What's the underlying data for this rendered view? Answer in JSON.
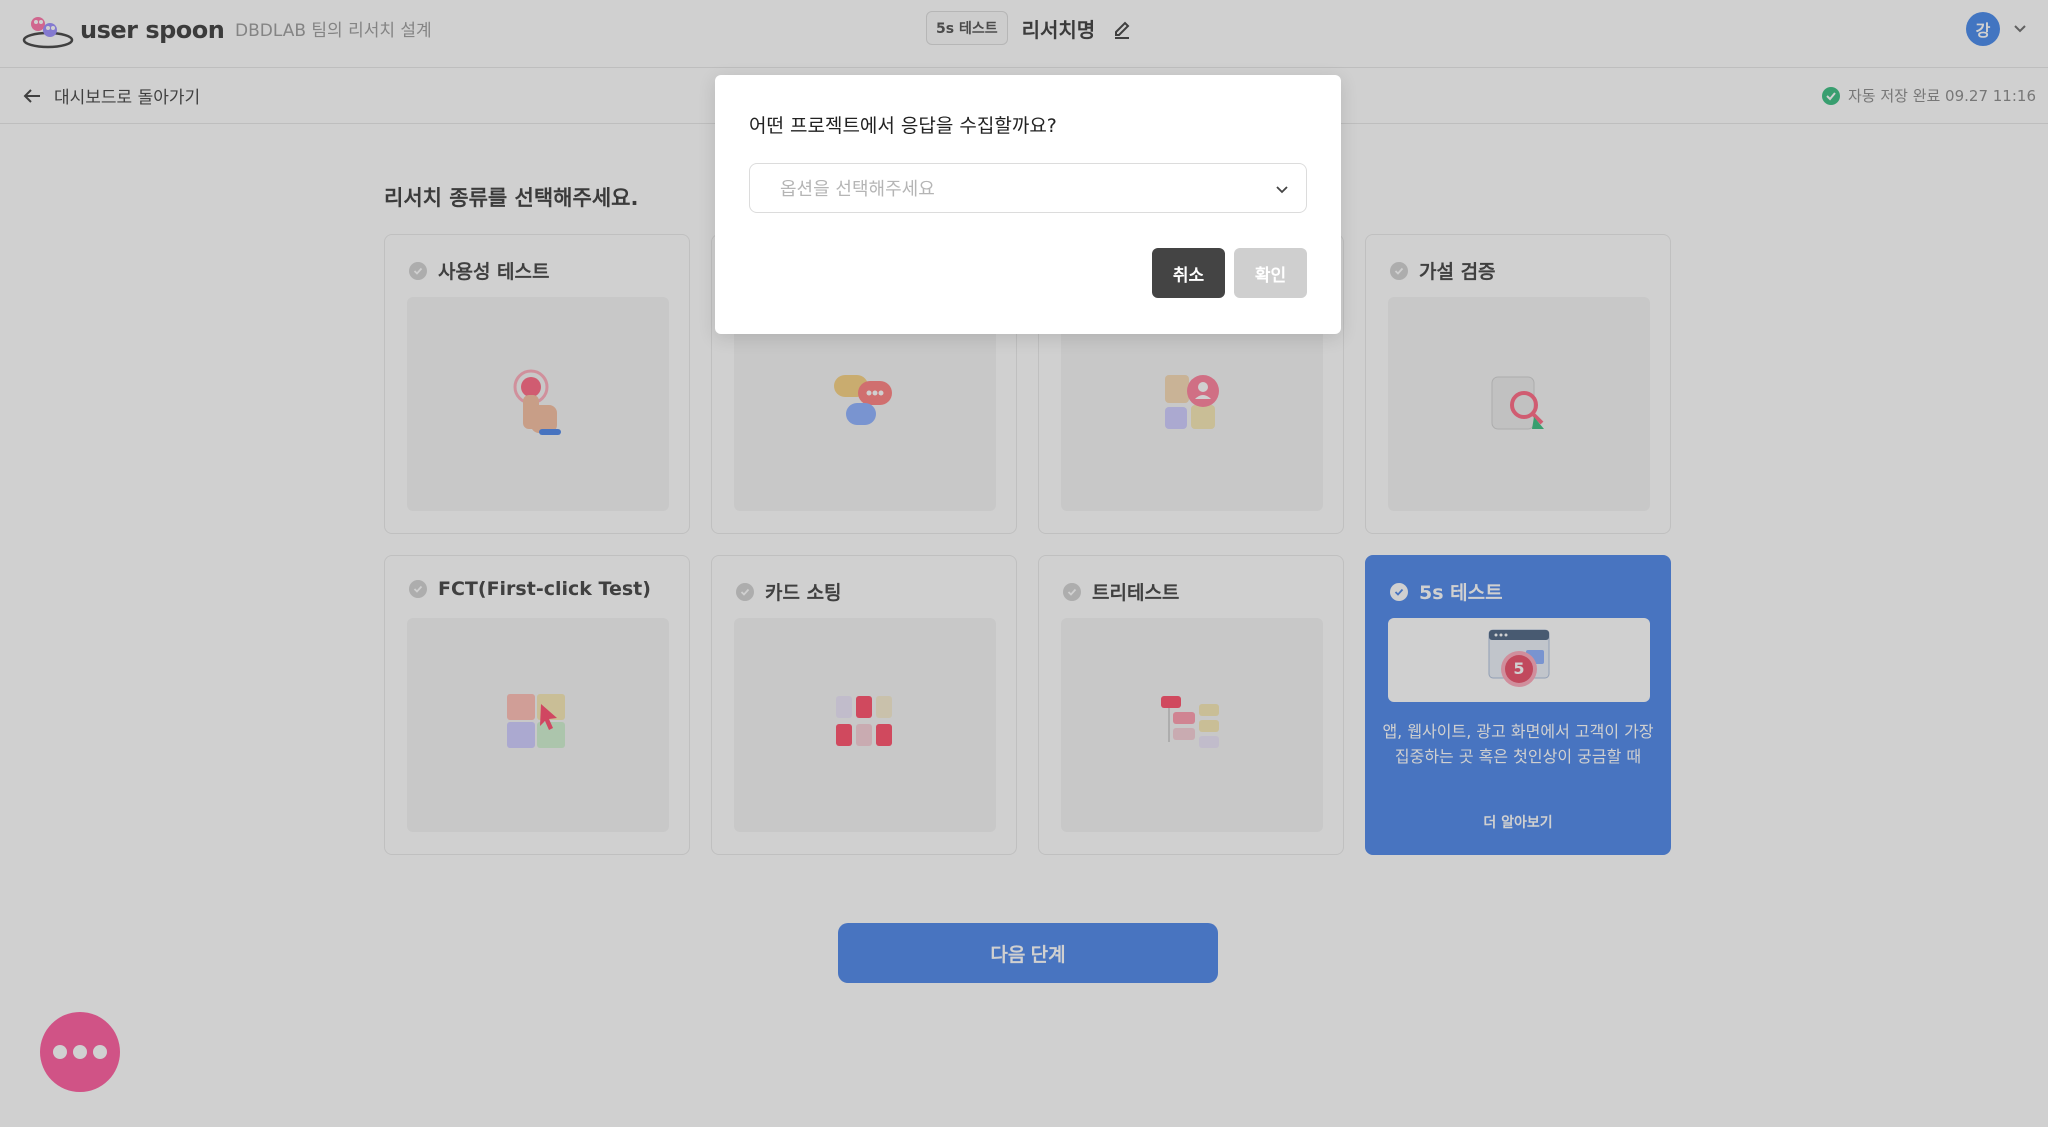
{
  "header": {
    "logo_text": "user spoon",
    "team_label": "DBDLAB 팀의 리서치 설계",
    "type_badge": "5s 테스트",
    "research_name": "리서치명",
    "avatar_initial": "강"
  },
  "subheader": {
    "back_label": "대시보드로 돌아가기",
    "autosave": "자동 저장 완료 09.27 11:16"
  },
  "main": {
    "section_title": "리서치 종류를 선택해주세요.",
    "cards": [
      {
        "title": "사용성 테스트",
        "icon": "touch-hand-icon"
      },
      {
        "title": "",
        "icon": "chat-bubbles-icon"
      },
      {
        "title": "",
        "icon": "user-persona-icon"
      },
      {
        "title": "가설 검증",
        "icon": "magnifier-document-icon"
      },
      {
        "title": "FCT(First-click Test)",
        "icon": "cursor-click-icon"
      },
      {
        "title": "카드 소팅",
        "icon": "card-sort-icon"
      },
      {
        "title": "트리테스트",
        "icon": "tree-diagram-icon"
      },
      {
        "title": "5s 테스트",
        "icon": "timer-5sec-icon",
        "selected": true,
        "description": "앱, 웹사이트, 광고 화면에서 고객이 가장 집중하는 곳 혹은 첫인상이 궁금할 때",
        "more_label": "더 알아보기"
      }
    ],
    "next_button": "다음 단계"
  },
  "modal": {
    "title": "어떤 프로젝트에서 응답을 수집할까요?",
    "select_placeholder": "옵션을 선택해주세요",
    "cancel_label": "취소",
    "confirm_label": "확인"
  },
  "colors": {
    "accent": "#2f72e6",
    "avatar": "#2573e8",
    "success": "#16b36b",
    "chat": "#ff3f8e"
  }
}
